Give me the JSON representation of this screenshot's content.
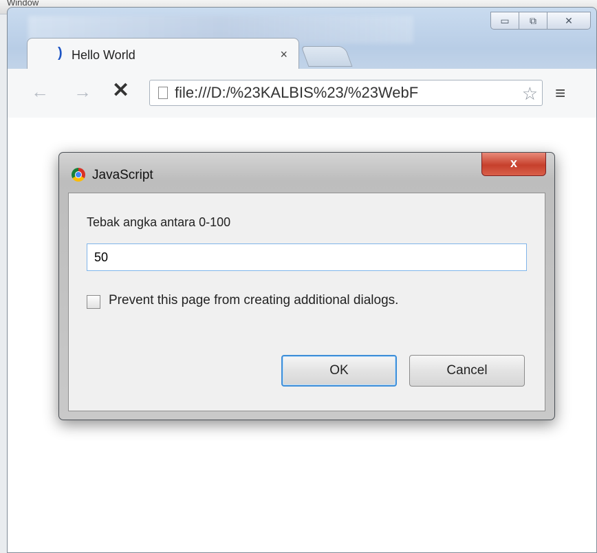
{
  "desktop": {
    "menu_text": "Window"
  },
  "browser": {
    "window_controls": {
      "minimize_icon": "minimize-icon",
      "maximize_icon": "maximize-icon",
      "close_glyph": "✕"
    },
    "tab": {
      "title": "Hello World",
      "close_glyph": "×"
    },
    "toolbar": {
      "back_glyph": "←",
      "forward_glyph": "→",
      "stop_glyph": "✕",
      "url": "file:///D:/%23KALBIS%23/%23WebF",
      "star_glyph": "☆",
      "menu_glyph": "≡"
    }
  },
  "dialog": {
    "title": "JavaScript",
    "close_glyph": "x",
    "message": "Tebak angka antara 0-100",
    "input_value": "50",
    "checkbox_label": "Prevent this page from creating additional dialogs.",
    "ok_label": "OK",
    "cancel_label": "Cancel"
  }
}
